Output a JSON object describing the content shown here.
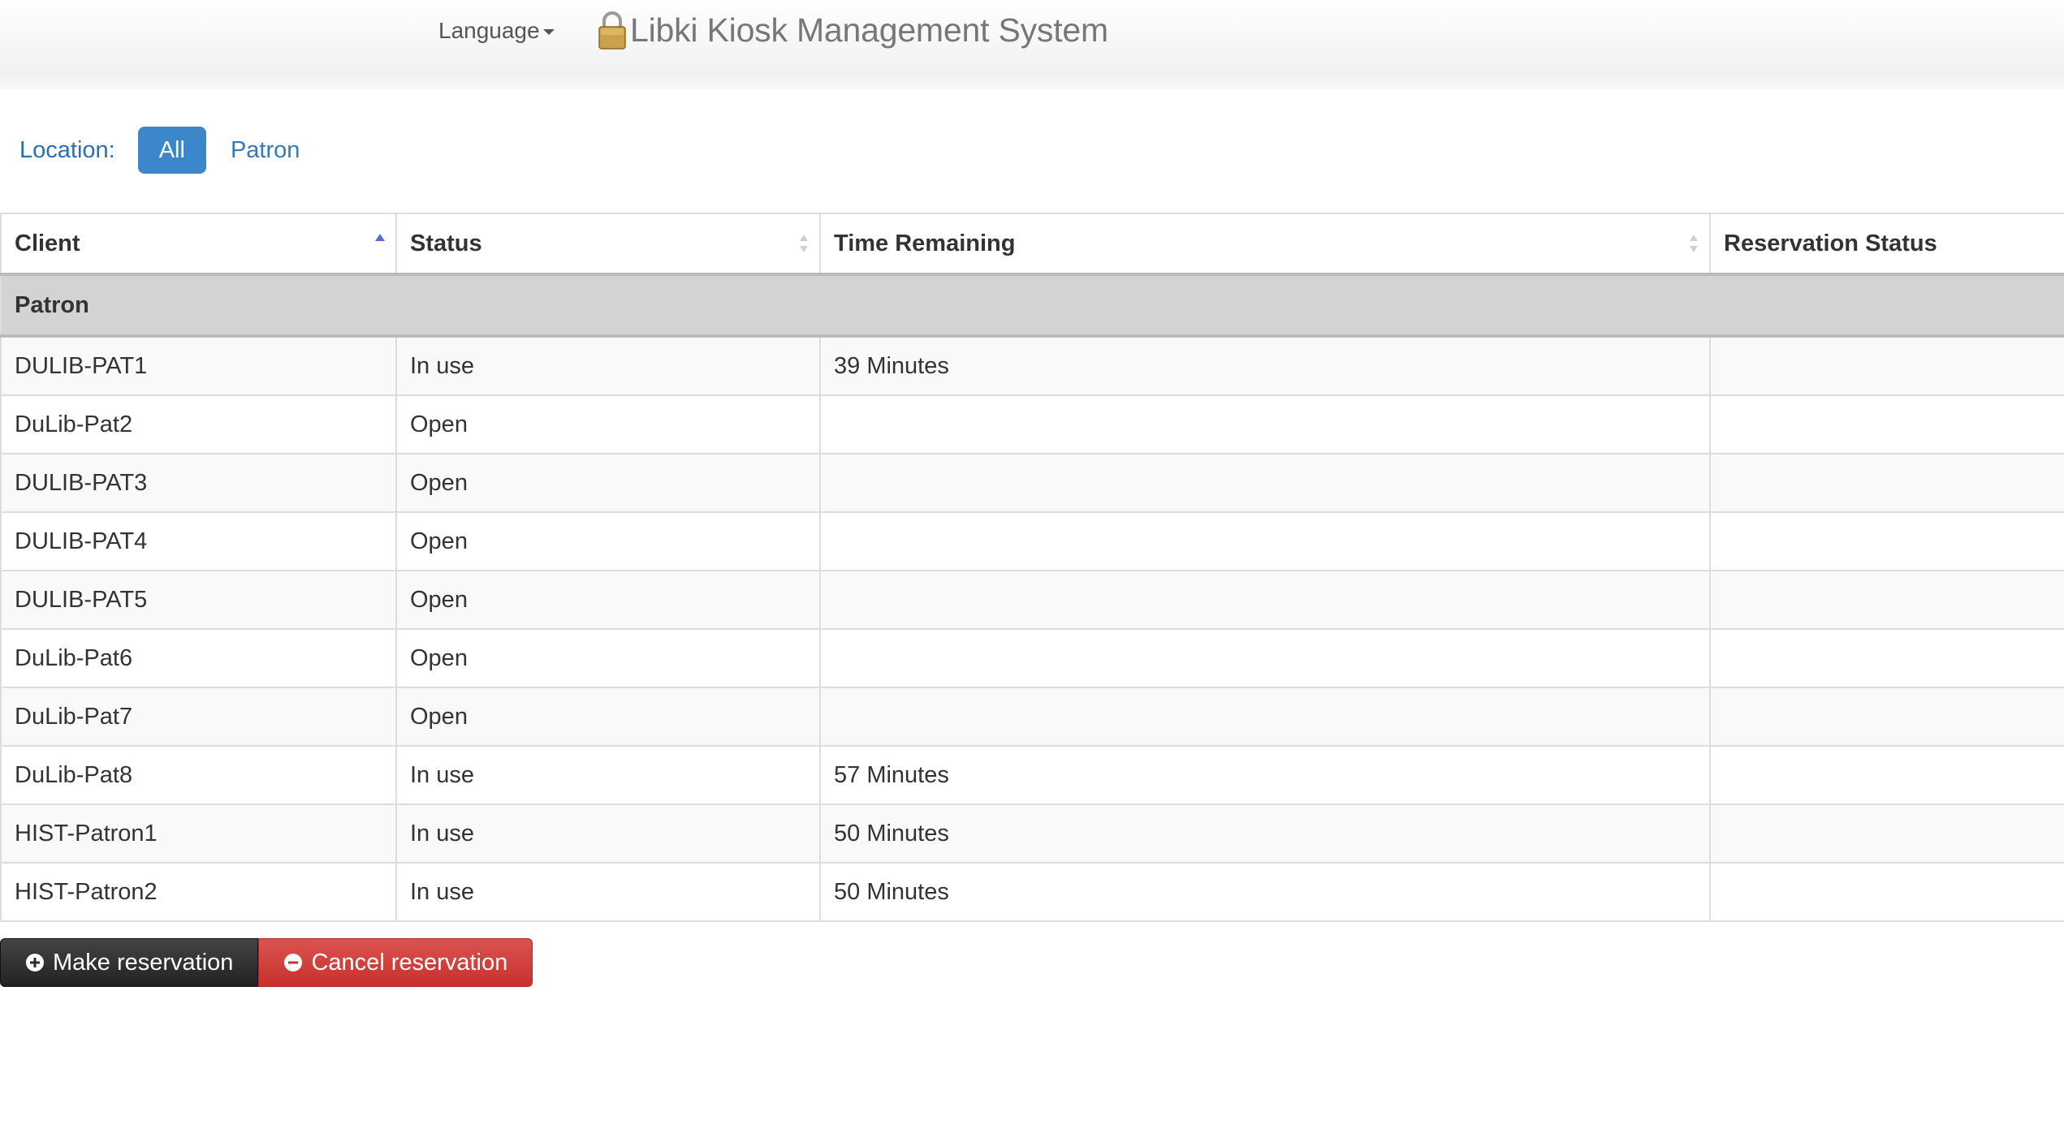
{
  "navbar": {
    "language_label": "Language",
    "brand_title": "Libki Kiosk Management System"
  },
  "location": {
    "label": "Location:",
    "filters": [
      "All",
      "Patron"
    ],
    "active": "All"
  },
  "table": {
    "headers": [
      "Client",
      "Status",
      "Time Remaining",
      "Reservation Status"
    ],
    "sorted_column": "Client",
    "group_label": "Patron",
    "rows": [
      {
        "client": "DULIB-PAT1",
        "status": "In use",
        "time": "39 Minutes",
        "reservation": ""
      },
      {
        "client": "DuLib-Pat2",
        "status": "Open",
        "time": "",
        "reservation": ""
      },
      {
        "client": "DULIB-PAT3",
        "status": "Open",
        "time": "",
        "reservation": ""
      },
      {
        "client": "DULIB-PAT4",
        "status": "Open",
        "time": "",
        "reservation": ""
      },
      {
        "client": "DULIB-PAT5",
        "status": "Open",
        "time": "",
        "reservation": ""
      },
      {
        "client": "DuLib-Pat6",
        "status": "Open",
        "time": "",
        "reservation": ""
      },
      {
        "client": "DuLib-Pat7",
        "status": "Open",
        "time": "",
        "reservation": ""
      },
      {
        "client": "DuLib-Pat8",
        "status": "In use",
        "time": "57 Minutes",
        "reservation": ""
      },
      {
        "client": "HIST-Patron1",
        "status": "In use",
        "time": "50 Minutes",
        "reservation": ""
      },
      {
        "client": "HIST-Patron2",
        "status": "In use",
        "time": "50 Minutes",
        "reservation": ""
      }
    ]
  },
  "actions": {
    "make_label": "Make reservation",
    "cancel_label": "Cancel reservation",
    "make_icon": "plus-circle-icon",
    "cancel_icon": "minus-circle-icon"
  },
  "colors": {
    "accent": "#3b87c9",
    "danger": "#d9534f",
    "dark": "#333333",
    "group_bg": "#d3d3d3"
  }
}
